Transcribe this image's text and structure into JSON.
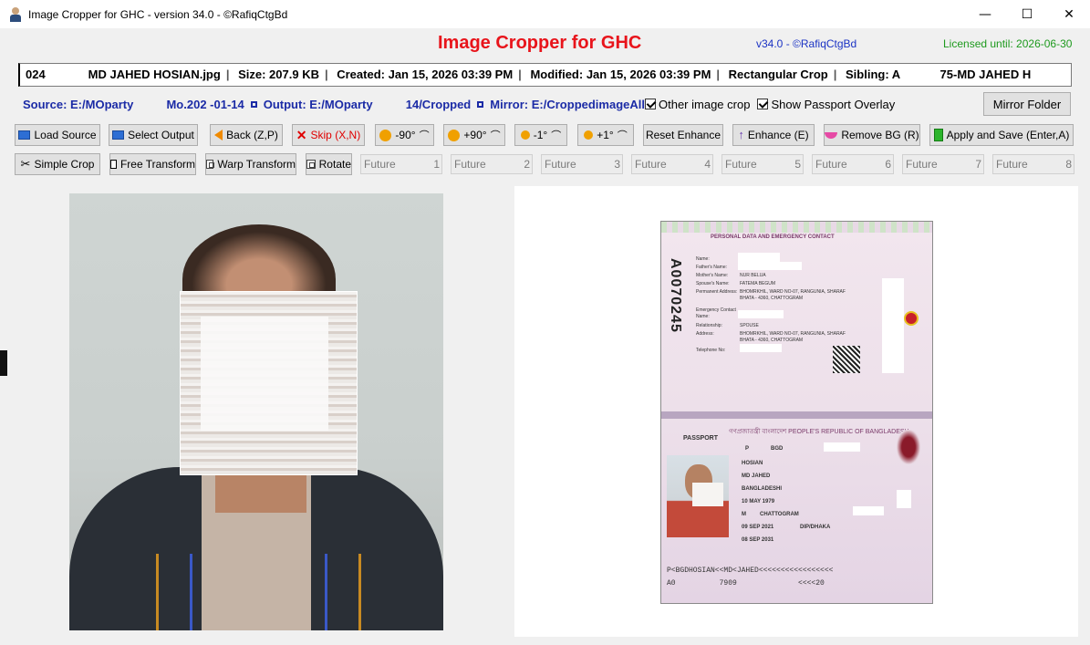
{
  "window": {
    "title": "Image Cropper for GHC - version 34.0 - ©RafiqCtgBd",
    "minimize_glyph": "—",
    "maximize_glyph": "☐",
    "close_glyph": "✕"
  },
  "header": {
    "app_name": "Image Cropper for GHC",
    "version": "v34.0 - ©RafiqCtgBd",
    "license": "Licensed until: 2026-06-30"
  },
  "info": {
    "file": "024             MD JAHED HOSIAN.jpg",
    "size": "Size: 207.9 KB",
    "created": "Created: Jan 15, 2026 03:39 PM",
    "modified": "Modified: Jan 15, 2026 03:39 PM",
    "crop_type": "Rectangular Crop",
    "sibling": "Sibling: A            75-MD JAHED H"
  },
  "paths": {
    "source": "Source: E:/MOparty          Mo.202 -01-14",
    "output": "Output: E:/MOparty          14/Cropped",
    "mirror": "Mirror: E:/CroppedimageAll"
  },
  "options": {
    "other_image_crop": "Other image crop",
    "show_passport_overlay": "Show Passport Overlay",
    "mirror_folder": "Mirror Folder"
  },
  "toolbar1": {
    "load_source": "Load Source",
    "select_output": "Select Output",
    "back": "Back (Z,P)",
    "skip": "Skip (X,N)",
    "rot_minus_90": "-90°",
    "rot_plus_90": "+90°",
    "rot_minus_1": "-1°",
    "rot_plus_1": "+1°",
    "reset_enhance": "Reset Enhance",
    "enhance": "Enhance (E)",
    "remove_bg": "Remove BG (R)",
    "apply_save": "Apply and Save (Enter,A)"
  },
  "toolbar2": {
    "simple_crop": "Simple Crop",
    "free_transform": "Free Transform",
    "warp_transform": "Warp Transform",
    "rotate": "Rotate",
    "futures": [
      {
        "label": "Future",
        "num": "1"
      },
      {
        "label": "Future",
        "num": "2"
      },
      {
        "label": "Future",
        "num": "3"
      },
      {
        "label": "Future",
        "num": "4"
      },
      {
        "label": "Future",
        "num": "5"
      },
      {
        "label": "Future",
        "num": "6"
      },
      {
        "label": "Future",
        "num": "7"
      },
      {
        "label": "Future",
        "num": "8"
      }
    ]
  },
  "passport": {
    "heading_top": "PERSONAL DATA AND EMERGENCY CONTACT",
    "fathers_name": "Father's Name:",
    "mothers_name": "Mother's Name:",
    "mother_value": "NUR BELUA",
    "spouse_name": "Spouse's Name:",
    "spouse_value": "FATEMA BEGUM",
    "permanent_address": "Permanent Address:",
    "permanent_value": "BHOMRKHIL, WARD NO-07, RANGUNIA, SHARAF BHATA - 4360, CHATTOGRAM",
    "emergency_contact": "Emergency Contact",
    "relationship": "Relationship:",
    "relationship_value": "SPOUSE",
    "address": "Address:",
    "address_value": "BHOMRKHIL, WARD NO-07, RANGUNIA, SHARAF BHATA - 4360, CHATTOGRAM",
    "telephone": "Telephone No:",
    "heading_bottom": "গণপ্রজাতন্ত্রী বাংলাদেশ   PEOPLE'S REPUBLIC OF BANGLADESH",
    "passport_label": "PASSPORT",
    "type": "P",
    "country": "BGD",
    "surname": "HOSIAN",
    "given_name": "MD JAHED",
    "nationality": "BANGLADESHI",
    "dob": "10 MAY 1979",
    "sex": "M",
    "birth_place": "CHATTOGRAM",
    "issue_date": "09 SEP 2021",
    "authority": "DIP/DHAKA",
    "expiry_date": "08 SEP 2031",
    "mrz1": "P<BGDHOSIAN<<MD<JAHED<<<<<<<<<<<<<<<<<",
    "mrz2": "A0          7909              <<<<20"
  },
  "colors": {
    "title_red": "#e8141b",
    "version_blue": "#1b33c4",
    "license_green": "#1e9a1e",
    "path_blue": "#1b2ba6"
  }
}
